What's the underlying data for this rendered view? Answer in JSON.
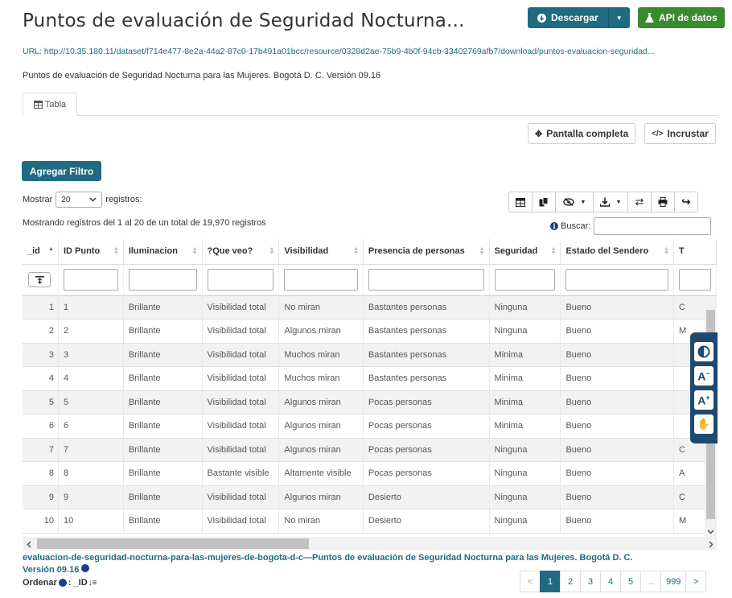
{
  "page": {
    "title": "Puntos de evaluación de Seguridad Nocturna...",
    "download_label": "Descargar",
    "api_label": "API de datos",
    "url_label": "URL:",
    "url": "http://10.35.180.11/dataset/f714e477-8e2a-44a2-87c0-17b491a01bcc/resource/0328d2ae-75b9-4b0f-94cb-33402769afb7/download/puntos-evaluacion-seguridad...",
    "description": "Puntos de evaluación de Seguridad Nocturna para las Mujeres. Bogotá D. C. Versión 09.16",
    "tab_label": "Tabla"
  },
  "toolbar": {
    "fullscreen_label": "Pantalla completa",
    "embed_label": "Incrustar",
    "add_filter_label": "Agregar Filtro",
    "show_label": "Mostrar",
    "page_size": "20",
    "records_label": "registros:",
    "info_text": "Mostrando registros del 1 al 20 de un total de 19,970 registros",
    "search_label": "Buscar:"
  },
  "table": {
    "headers": [
      "_id",
      "ID Punto",
      "Iluminacion",
      "?Que veo?",
      "Visibilidad",
      "Presencia de personas",
      "Seguridad",
      "Estado del Sendero",
      "T"
    ],
    "rows": [
      [
        "1",
        "1",
        "Brillante",
        "Visibilidad total",
        "No miran",
        "Bastantes personas",
        "Ninguna",
        "Bueno",
        "C"
      ],
      [
        "2",
        "2",
        "Brillante",
        "Visibilidad total",
        "Algunos miran",
        "Bastantes personas",
        "Ninguna",
        "Bueno",
        "M"
      ],
      [
        "3",
        "3",
        "Brillante",
        "Visibilidad total",
        "Muchos miran",
        "Bastantes personas",
        "Minima",
        "Bueno",
        ""
      ],
      [
        "4",
        "4",
        "Brillante",
        "Visibilidad total",
        "Muchos miran",
        "Bastantes personas",
        "Minima",
        "Bueno",
        ""
      ],
      [
        "5",
        "5",
        "Brillante",
        "Visibilidad total",
        "Algunos miran",
        "Pocas personas",
        "Minima",
        "Bueno",
        ""
      ],
      [
        "6",
        "6",
        "Brillante",
        "Visibilidad total",
        "Algunos miran",
        "Pocas personas",
        "Minima",
        "Bueno",
        ""
      ],
      [
        "7",
        "7",
        "Brillante",
        "Visibilidad total",
        "Algunos miran",
        "Pocas personas",
        "Ninguna",
        "Bueno",
        "C"
      ],
      [
        "8",
        "8",
        "Brillante",
        "Bastante visible",
        "Altamente visible",
        "Pocas personas",
        "Ninguna",
        "Bueno",
        "A"
      ],
      [
        "9",
        "9",
        "Brillante",
        "Visibilidad total",
        "Algunos miran",
        "Desierto",
        "Ninguna",
        "Bueno",
        "C"
      ],
      [
        "10",
        "10",
        "Brillante",
        "Visibilidad total",
        "No miran",
        "Desierto",
        "Ninguna",
        "Bueno",
        "M"
      ]
    ]
  },
  "footer": {
    "resource_text": "evaluacion-de-seguridad-nocturna-para-las-mujeres-de-bogota-d-c—Puntos de evaluación de Seguridad Nocturna para las Mujeres. Bogotá D. C.",
    "version_text": "Versión 09.16",
    "order_label": "Ordenar",
    "order_value": ": _ID"
  },
  "pagination": [
    "<",
    "1",
    "2",
    "3",
    "4",
    "5",
    "...",
    "999",
    ">"
  ],
  "colors": {
    "primary": "#206b82",
    "success": "#378b2c",
    "accessibility": "#1d4a6e"
  }
}
